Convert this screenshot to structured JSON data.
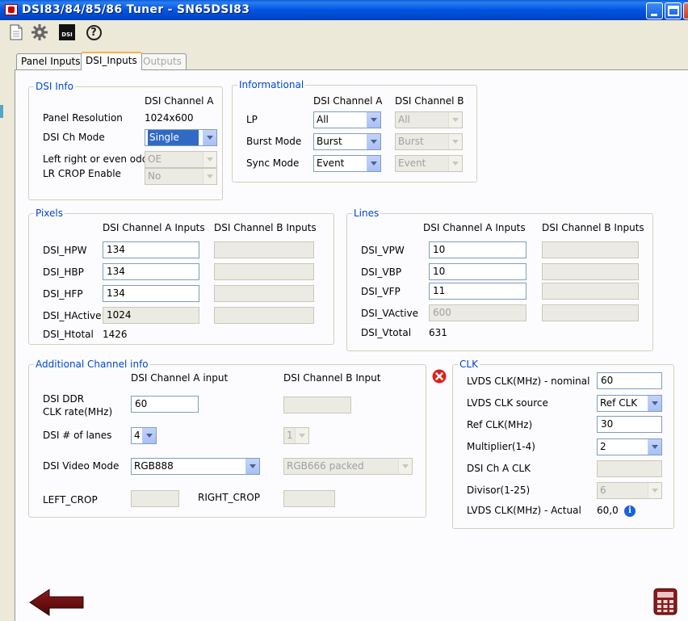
{
  "window": {
    "title": "DSI83/84/85/86 Tuner - SN65DSI83"
  },
  "toolbar": {
    "icons": [
      "document-icon",
      "gear-icon",
      "dsi-icon",
      "help-icon"
    ],
    "dsi_label": "DSI",
    "help_glyph": "?"
  },
  "tabs": [
    {
      "label": "Panel Inputs"
    },
    {
      "label": "DSI_Inputs"
    },
    {
      "label": "Outputs"
    }
  ],
  "dsi_info": {
    "legend": "DSI Info",
    "channel_header": "DSI Channel A",
    "panel_resolution_label": "Panel Resolution",
    "panel_resolution_value": "1024x600",
    "ch_mode_label": "DSI Ch Mode",
    "ch_mode_value": "Single",
    "lr_odd_label": "Left right or even odd",
    "lr_odd_value": "OE",
    "lr_crop_label": "LR CROP Enable",
    "lr_crop_value": "No"
  },
  "informational": {
    "legend": "Informational",
    "header_a": "DSI Channel A",
    "header_b": "DSI Channel B",
    "lp_label": "LP",
    "lp_a": "All",
    "lp_b": "All",
    "burst_label": "Burst Mode",
    "burst_a": "Burst",
    "burst_b": "Burst",
    "sync_label": "Sync Mode",
    "sync_a": "Event",
    "sync_b": "Event"
  },
  "pixels": {
    "legend": "Pixels",
    "header_a": "DSI Channel A Inputs",
    "header_b": "DSI Channel B Inputs",
    "hpw_label": "DSI_HPW",
    "hpw_a": "134",
    "hpw_b": "",
    "hbp_label": "DSI_HBP",
    "hbp_a": "134",
    "hbp_b": "",
    "hfp_label": "DSI_HFP",
    "hfp_a": "134",
    "hfp_b": "",
    "hactive_label": "DSI_HActive",
    "hactive_a": "1024",
    "hactive_b": "",
    "htotal_label": "DSI_Htotal",
    "htotal_value": "1426"
  },
  "lines": {
    "legend": "Lines",
    "header_a": "DSI Channel A Inputs",
    "header_b": "DSI Channel B Inputs",
    "vpw_label": "DSI_VPW",
    "vpw_a": "10",
    "vpw_b": "",
    "vbp_label": "DSI_VBP",
    "vbp_a": "10",
    "vbp_b": "",
    "vfp_label": "DSI_VFP",
    "vfp_a": "11",
    "vfp_b": "",
    "vactive_label": "DSI_VActive",
    "vactive_a": "600",
    "vactive_b": "",
    "vtotal_label": "DSI_Vtotal",
    "vtotal_value": "631"
  },
  "additional": {
    "legend": "Additional Channel info",
    "header_a": "DSI Channel A input",
    "header_b": "DSI Channel B Input",
    "ddr_label_1": "DSI DDR",
    "ddr_label_2": "CLK rate(MHz)",
    "ddr_a": "60",
    "ddr_b": "",
    "lanes_label": "DSI # of lanes",
    "lanes_a": "4",
    "lanes_b": "1",
    "video_mode_label": "DSI Video Mode",
    "video_mode_a": "RGB888",
    "video_mode_b": "RGB666 packed",
    "left_crop_label": "LEFT_CROP",
    "left_crop_value": "",
    "right_crop_label": "RIGHT_CROP",
    "right_crop_value": ""
  },
  "clk": {
    "legend": "CLK",
    "nominal_label": "LVDS CLK(MHz) - nominal",
    "nominal_value": "60",
    "source_label": "LVDS CLK source",
    "source_value": "Ref CLK",
    "ref_label": "Ref CLK(MHz)",
    "ref_value": "30",
    "multiplier_label": "Multiplier(1-4)",
    "multiplier_value": "2",
    "ch_a_clk_label": "DSI Ch A CLK",
    "ch_a_clk_value": "",
    "divisor_label": "Divisor(1-25)",
    "divisor_value": "6",
    "actual_label": "LVDS CLK(MHz) - Actual",
    "actual_value": "60,0",
    "info_glyph": "i"
  },
  "colors": {
    "titlebar": "#0054e3",
    "legend_text": "#0046d5",
    "error_icon": "#e0201c",
    "back_arrow": "#6b0e0e",
    "calculator": "#8b1a1a",
    "info_icon": "#1a5fe0"
  }
}
